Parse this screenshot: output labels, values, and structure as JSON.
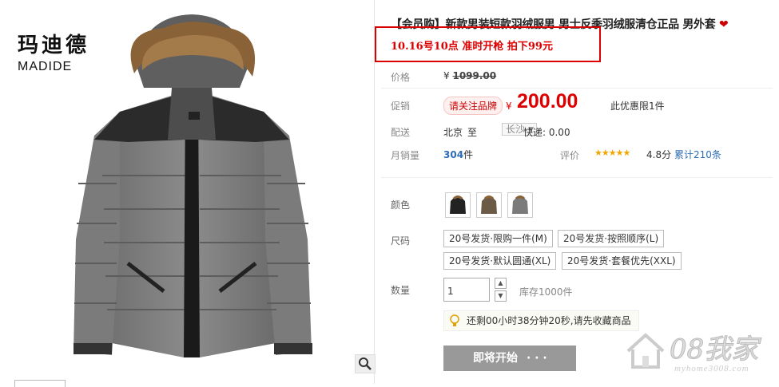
{
  "brand": {
    "cn": "玛迪德",
    "en": "MADIDE"
  },
  "product": {
    "title": "【会员购】新款男装短款羽绒服男 男士反季羽绒服清仓正品 男外套",
    "heart": "❤",
    "promo": "10.16号10点 准时开枪 拍下99元"
  },
  "price": {
    "label": "价格",
    "currency": "¥",
    "original": "1099.00"
  },
  "promotion": {
    "label": "促销",
    "badge": "请关注品牌",
    "currency": "¥",
    "price": "200.00",
    "limit": "此优惠限1件"
  },
  "shipping": {
    "label": "配送",
    "from": "北京",
    "to_word": "至",
    "dest": "长沙",
    "fee": "快递: 0.00"
  },
  "sales": {
    "label": "月销量",
    "count": "304",
    "unit": "件",
    "rating_label": "评价",
    "stars": "★★★★★",
    "score": "4.8分",
    "reviews": "累计210条"
  },
  "color": {
    "label": "颜色",
    "options": [
      "black",
      "brown",
      "gray"
    ]
  },
  "size": {
    "label": "尺码",
    "options": [
      "20号发货·限购一件(M)",
      "20号发货·按照顺序(L)",
      "20号发货·默认圆通(XL)",
      "20号发货·套餐优先(XXL)"
    ]
  },
  "quantity": {
    "label": "数量",
    "value": "1",
    "stock": "库存1000件"
  },
  "tip": {
    "text": "还剩00小时38分钟20秒,请先收藏商品"
  },
  "buy_button": {
    "label": "即将开始",
    "dots": "· · ·"
  },
  "watermark": {
    "big": "08我家",
    "small": "myhome3008.com"
  },
  "colors": {
    "price_red": "#dd0000",
    "promo_border": "#dd0000",
    "link_blue": "#2f6db5",
    "button_gray": "#999999"
  }
}
